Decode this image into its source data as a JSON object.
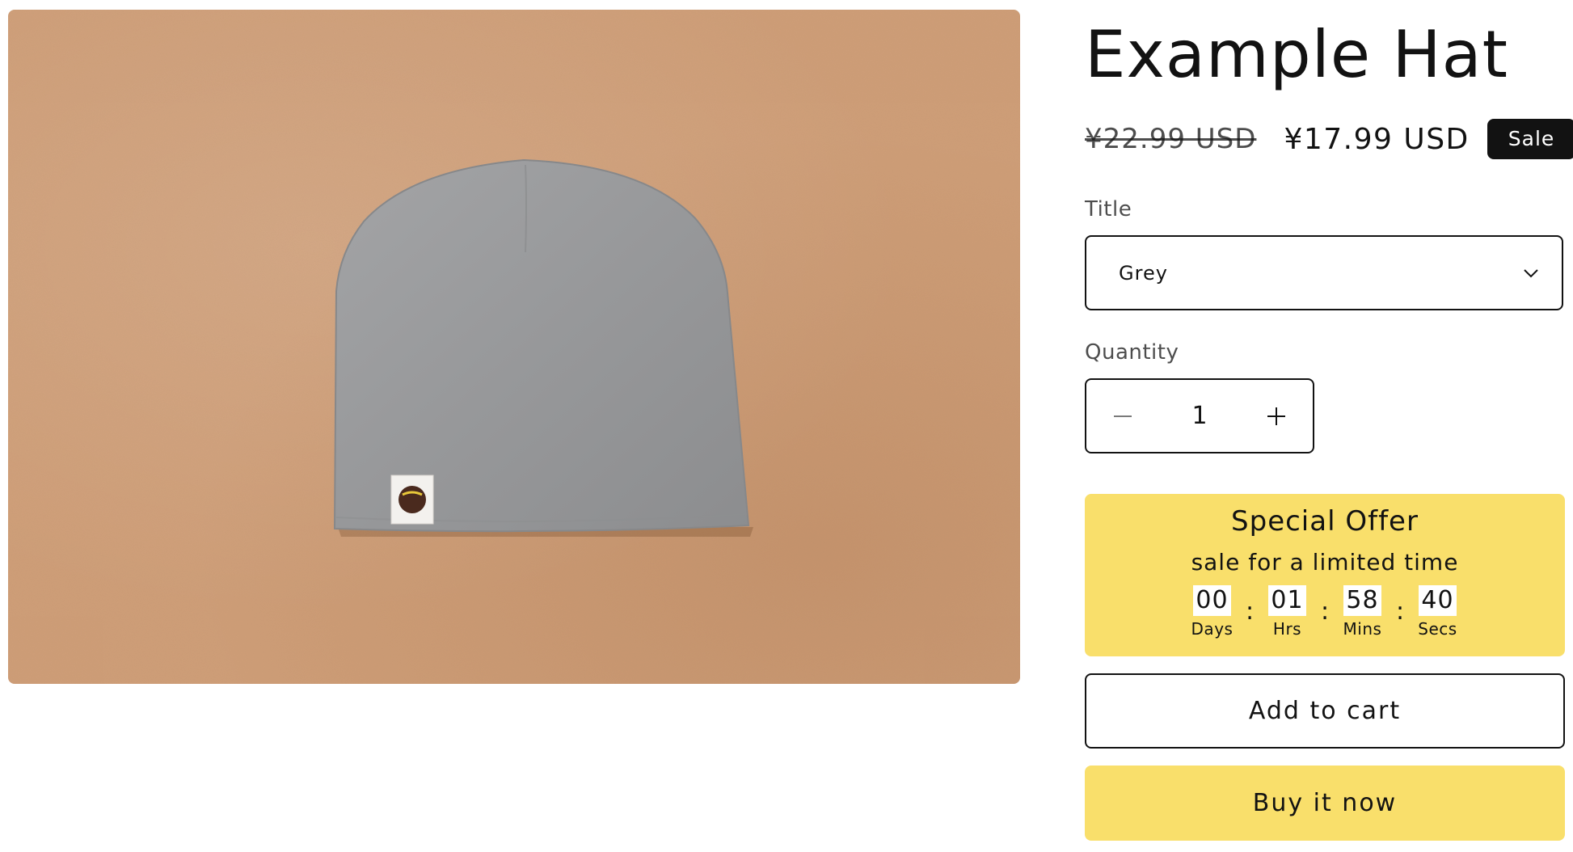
{
  "product": {
    "title": "Example Hat",
    "price_compare": "¥22.99 USD",
    "price_sale": "¥17.99 USD",
    "badge": "Sale",
    "image_alt": "Grey beanie hat on brown board"
  },
  "variant": {
    "label": "Title",
    "selected": "Grey"
  },
  "quantity": {
    "label": "Quantity",
    "value": "1",
    "minus": "−",
    "plus": "+"
  },
  "offer": {
    "title": "Special Offer",
    "subtitle": "sale for a limited time",
    "timer": [
      {
        "value": "00",
        "label": "Days"
      },
      {
        "value": "01",
        "label": "Hrs"
      },
      {
        "value": "58",
        "label": "Mins"
      },
      {
        "value": "40",
        "label": "Secs"
      }
    ],
    "separator": ":"
  },
  "buttons": {
    "add_to_cart": "Add to cart",
    "buy_now": "Buy it now"
  },
  "colors": {
    "accent_yellow": "#f9df6b",
    "text": "#121212",
    "badge_bg": "#121212",
    "board_brown": "#cf9e78",
    "hat_grey": "#9a9b9d"
  },
  "icons": {
    "select_chevron": "chevron-down-icon"
  }
}
